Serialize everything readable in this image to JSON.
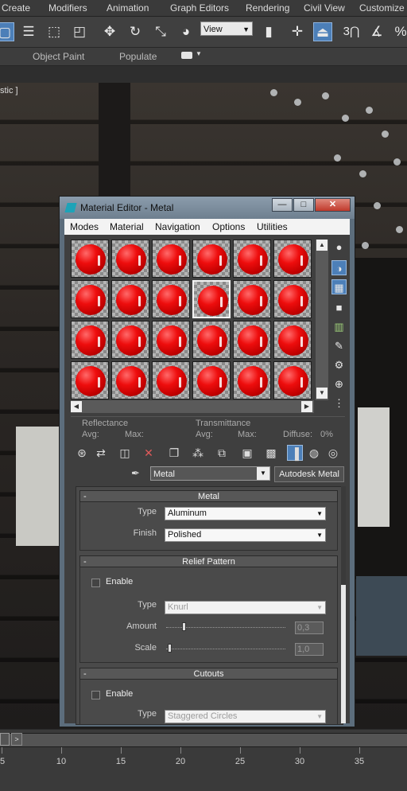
{
  "app_menu": [
    "Create",
    "Modifiers",
    "Animation",
    "Graph Editors",
    "Rendering",
    "Civil View",
    "Customize"
  ],
  "toolbar": {
    "view_dropdown": "View",
    "snap_label": "3"
  },
  "ribbon": {
    "object_paint": "Object Paint",
    "populate": "Populate"
  },
  "viewport": {
    "label": "stic ]"
  },
  "timeline": {
    "next_label": ">",
    "ticks": [
      "5",
      "10",
      "15",
      "20",
      "25",
      "30",
      "35"
    ]
  },
  "material_editor": {
    "title": "Material Editor - Metal",
    "window_buttons": {
      "minimize": "—",
      "maximize": "□",
      "close": "✕"
    },
    "menu": [
      "Modes",
      "Material",
      "Navigation",
      "Options",
      "Utilities"
    ],
    "reflectance": {
      "reflectance_label": "Reflectance",
      "avg_label": "Avg:",
      "max_label": "Max:",
      "transmittance_label": "Transmittance",
      "t_avg_label": "Avg:",
      "t_max_label": "Max:",
      "diffuse_label": "Diffuse:",
      "diffuse_value": "0%"
    },
    "material_name": "Metal",
    "material_type": "Autodesk Metal",
    "rollouts": {
      "metal": {
        "title": "Metal",
        "type_label": "Type",
        "type_value": "Aluminum",
        "finish_label": "Finish",
        "finish_value": "Polished"
      },
      "relief_pattern": {
        "title": "Relief Pattern",
        "enable_label": "Enable",
        "enabled": false,
        "type_label": "Type",
        "type_value": "Knurl",
        "amount_label": "Amount",
        "amount_value": "0,3",
        "scale_label": "Scale",
        "scale_value": "1,0"
      },
      "cutouts": {
        "title": "Cutouts",
        "enable_label": "Enable",
        "enabled": false,
        "type_label": "Type",
        "type_value": "Staggered Circles"
      }
    },
    "rollout_minus": "-",
    "slot_count": 24,
    "selected_slot": 9
  }
}
